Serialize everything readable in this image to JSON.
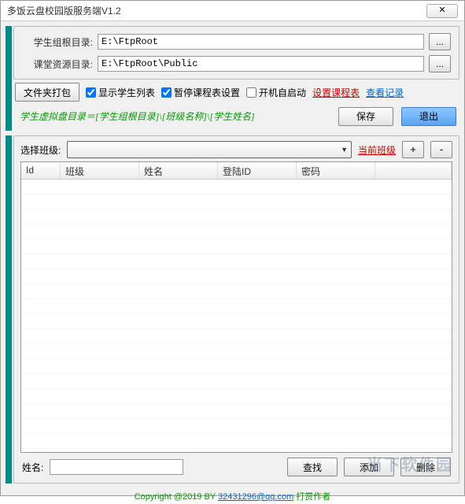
{
  "titlebar": {
    "title": "多饭云盘校园版服务端V1.2",
    "close": "✕"
  },
  "dir": {
    "student_label": "学生组根目录:",
    "student_value": "E:\\FtpRoot",
    "class_label": "课堂资源目录:",
    "class_value": "E:\\FtpRoot\\Public",
    "browse": "..."
  },
  "toolbar": {
    "pack_btn": "文件夹打包",
    "chk_show_list": "显示学生列表",
    "chk_pause": "暂停课程表设置",
    "chk_autostart": "开机自启动",
    "set_schedule": "设置课程表",
    "view_log": "查看记录"
  },
  "hint": "学生虚拟盘目录＝[学生组根目录]\\[班级名称]\\[学生姓名]",
  "actions": {
    "save": "保存",
    "exit": "退出"
  },
  "class_sel": {
    "label": "选择班级:",
    "current": "当前班级",
    "plus": "+",
    "minus": "-"
  },
  "table": {
    "headers": {
      "id": "Id",
      "class": "班级",
      "name": "姓名",
      "login": "登陆ID",
      "pwd": "密码"
    }
  },
  "bottom": {
    "name_label": "姓名:",
    "find": "查找",
    "add": "添加",
    "del": "删除"
  },
  "copyright": {
    "prefix": "Copyright @2019 BY ",
    "email": "32431296@qq.com",
    "suffix": " 打赏作者"
  },
  "watermark": "当下软件园"
}
